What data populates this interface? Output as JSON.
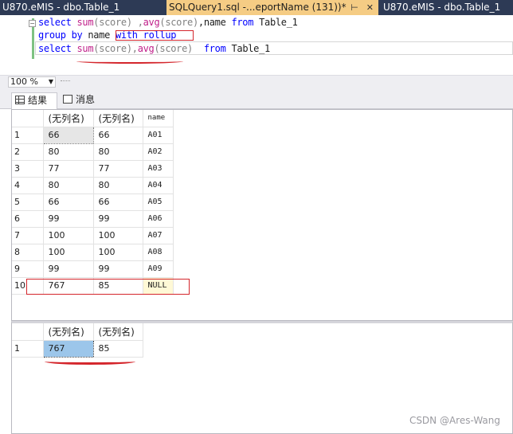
{
  "tabs": [
    {
      "label": "U870.eMIS - dbo.Table_1",
      "active": false
    },
    {
      "label": "SQLQuery1.sql -...eportName (131))*",
      "active": true,
      "pin_icon": "pin-icon",
      "close_icon": "close-icon"
    },
    {
      "label": "U870.eMIS - dbo.Table_1",
      "active": false
    }
  ],
  "editor": {
    "line1": {
      "kw1": "select",
      "fn1": "sum",
      "arg1": "(score)",
      "sep1": " ,",
      "fn2": "avg",
      "arg2": "(score)",
      "rest": ",name",
      "kw2": "from",
      "tbl": "Table_1"
    },
    "line2": {
      "kw1": "group",
      "kw2": "by",
      "col": "name",
      "kw3": "with",
      "kw4": "rollup"
    },
    "line3": {
      "kw1": "select",
      "fn1": "sum",
      "arg1": "(score)",
      "sep": ",",
      "fn2": "avg",
      "arg2": "(score)",
      "kw2": "from",
      "tbl": "Table_1"
    }
  },
  "zoom": {
    "value": "100 %"
  },
  "result_tabs": {
    "results": "结果",
    "messages": "消息"
  },
  "grid1": {
    "headers": [
      "(无列名)",
      "(无列名)",
      "name"
    ],
    "rows": [
      {
        "n": "1",
        "a": "66",
        "b": "66",
        "c": "A01"
      },
      {
        "n": "2",
        "a": "80",
        "b": "80",
        "c": "A02"
      },
      {
        "n": "3",
        "a": "77",
        "b": "77",
        "c": "A03"
      },
      {
        "n": "4",
        "a": "80",
        "b": "80",
        "c": "A04"
      },
      {
        "n": "5",
        "a": "66",
        "b": "66",
        "c": "A05"
      },
      {
        "n": "6",
        "a": "99",
        "b": "99",
        "c": "A06"
      },
      {
        "n": "7",
        "a": "100",
        "b": "100",
        "c": "A07"
      },
      {
        "n": "8",
        "a": "100",
        "b": "100",
        "c": "A08"
      },
      {
        "n": "9",
        "a": "99",
        "b": "99",
        "c": "A09"
      },
      {
        "n": "10",
        "a": "767",
        "b": "85",
        "c": "NULL"
      }
    ]
  },
  "grid2": {
    "headers": [
      "(无列名)",
      "(无列名)"
    ],
    "rows": [
      {
        "n": "1",
        "a": "767",
        "b": "85"
      }
    ]
  },
  "watermark": "CSDN @Ares-Wang",
  "colors": {
    "tab_bg": "#2d3a55",
    "active_tab": "#f5cc84",
    "keyword": "#0000ff",
    "function": "#c0208a",
    "annotation_red": "#d4262c",
    "selected_cell": "#9cc6ea"
  }
}
